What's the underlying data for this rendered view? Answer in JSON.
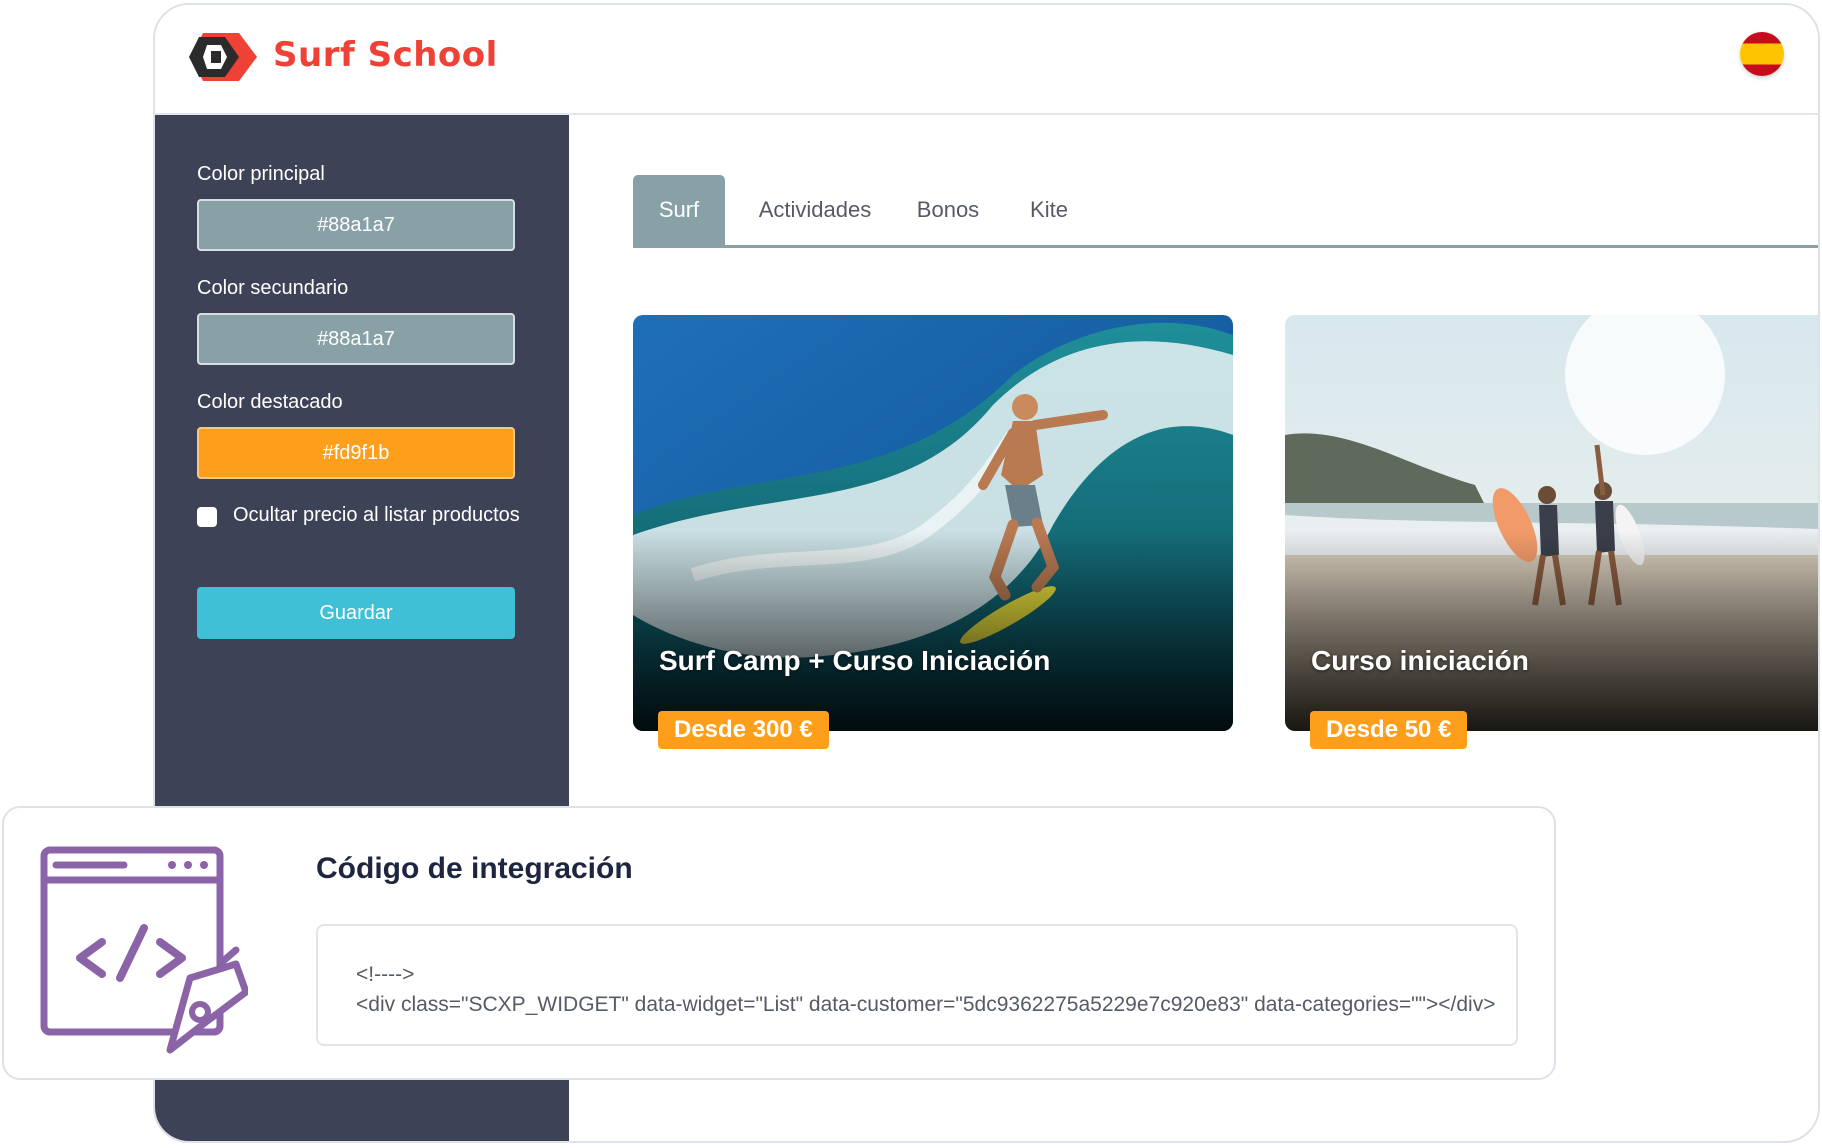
{
  "header": {
    "brand": "Surf School",
    "language_flag": "es-flag-icon"
  },
  "sidebar": {
    "primary": {
      "label": "Color principal",
      "value": "#88a1a7",
      "color": "#88a1a7"
    },
    "secondary": {
      "label": "Color secundario",
      "value": "#88a1a7",
      "color": "#88a1a7"
    },
    "highlight": {
      "label": "Color destacado",
      "value": "#fd9f1b",
      "color": "#fd9f1b"
    },
    "hide_price_label": "Ocultar precio al listar productos",
    "save_label": "Guardar"
  },
  "tabs": [
    {
      "label": "Surf",
      "active": true
    },
    {
      "label": "Actividades"
    },
    {
      "label": "Bonos"
    },
    {
      "label": "Kite"
    }
  ],
  "products": [
    {
      "title": "Surf Camp + Curso Iniciación",
      "price": "Desde 300 €"
    },
    {
      "title": "Curso iniciación",
      "price": "Desde 50 €"
    }
  ],
  "integration": {
    "title": "Código de integración",
    "code_line1": "<!---->",
    "code_line2": "<div class=\"SCXP_WIDGET\" data-widget=\"List\" data-customer=\"5dc9362275a5229e7c920e83\" data-categories=\"\"></div>"
  },
  "colors": {
    "accent": "#ef4136",
    "sidebar_bg": "#3e4257",
    "save_button": "#3fc0d6",
    "highlight": "#fd9f1b",
    "icon_purple": "#8b64a8"
  }
}
